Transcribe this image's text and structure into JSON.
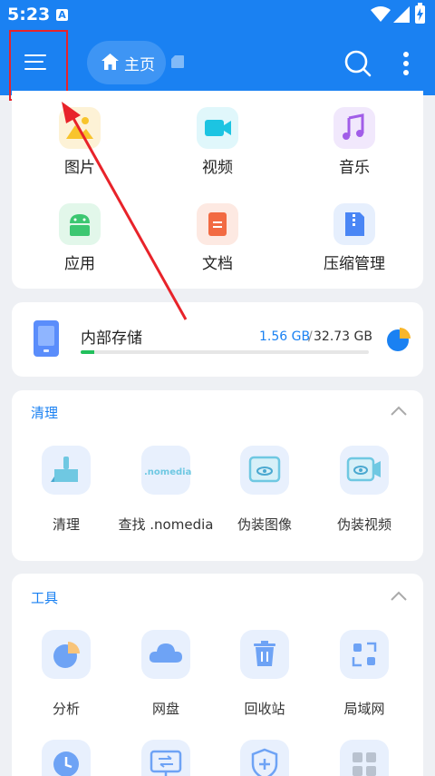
{
  "status_bar": {
    "time": "5:23"
  },
  "header": {
    "home_label": "主页"
  },
  "categories": [
    {
      "label": "图片",
      "icon": "image-icon",
      "bg": "#fdf2d6",
      "fg": "#f8c42c"
    },
    {
      "label": "视频",
      "icon": "video-icon",
      "bg": "#e0f7fb",
      "fg": "#1cc4e2"
    },
    {
      "label": "音乐",
      "icon": "music-icon",
      "bg": "#f1e8fc",
      "fg": "#a15de8"
    },
    {
      "label": "应用",
      "icon": "android-icon",
      "bg": "#e2f7ea",
      "fg": "#3cc771"
    },
    {
      "label": "文档",
      "icon": "document-icon",
      "bg": "#fde9e2",
      "fg": "#f26a42"
    },
    {
      "label": "压缩管理",
      "icon": "archive-icon",
      "bg": "#e6effd",
      "fg": "#4a86f5"
    }
  ],
  "storage": {
    "name": "内部存储",
    "used": "1.56 GB",
    "separator": "/",
    "total": "32.73 GB",
    "used_fraction": 0.048
  },
  "clean_section": {
    "title": "清理",
    "items": [
      {
        "label": "清理",
        "icon": "broom-icon"
      },
      {
        "label": "查找 .nomedia",
        "icon": "nomedia-icon",
        "icon_text": ".nomedia"
      },
      {
        "label": "伪装图像",
        "icon": "hidden-image-icon"
      },
      {
        "label": "伪装视频",
        "icon": "hidden-video-icon"
      }
    ]
  },
  "tools_section": {
    "title": "工具",
    "items": [
      {
        "label": "分析",
        "icon": "analyze-pie-icon"
      },
      {
        "label": "网盘",
        "icon": "cloud-icon"
      },
      {
        "label": "回收站",
        "icon": "recycle-bin-icon"
      },
      {
        "label": "局域网",
        "icon": "lan-icon"
      },
      {
        "label": "",
        "icon": "clock-icon"
      },
      {
        "label": "",
        "icon": "monitor-transfer-icon"
      },
      {
        "label": "",
        "icon": "shield-plus-icon"
      },
      {
        "label": "",
        "icon": "grid-apps-icon"
      }
    ]
  },
  "colors": {
    "primary": "#1a81f2",
    "annotation": "#e8232a",
    "storage_bar": "#22c05c",
    "icon_bg": "#e8f0fd"
  }
}
